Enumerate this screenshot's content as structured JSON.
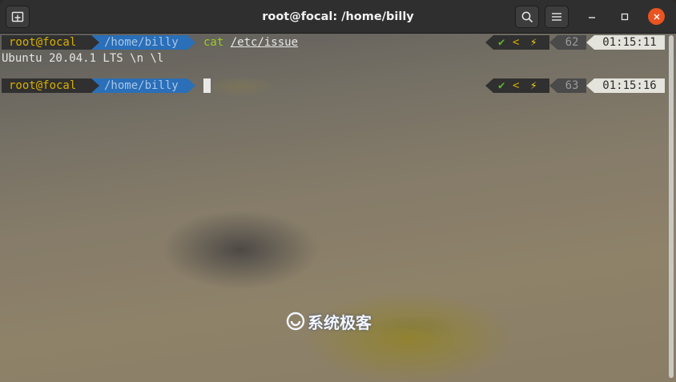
{
  "window": {
    "title": "root@focal: /home/billy"
  },
  "titlebar": {
    "new_tab_icon": "new-tab-icon",
    "search_icon": "search-icon",
    "menu_icon": "hamburger-menu-icon",
    "minimize_icon": "minimize-icon",
    "maximize_icon": "maximize-icon",
    "close_icon": "close-icon"
  },
  "colors": {
    "close_button": "#e95420",
    "prompt_user_fg": "#d7af00",
    "prompt_dir_bg": "#2a6fb8",
    "command_fg": "#9ccc1e",
    "time_bg": "#e4e4dc"
  },
  "terminal": {
    "lines": [
      {
        "user": "root@focal",
        "dir": "/home/billy",
        "command": "cat",
        "argument": "/etc/issue",
        "status_ok": "✔",
        "history_number": "62",
        "time": "01:15:11"
      },
      {
        "output": "Ubuntu 20.04.1 LTS \\n \\l"
      },
      {
        "user": "root@focal",
        "dir": "/home/billy",
        "command": "",
        "argument": "",
        "status_ok": "✔",
        "history_number": "63",
        "time": "01:15:16"
      }
    ]
  },
  "watermark": {
    "text": "系统极客"
  }
}
